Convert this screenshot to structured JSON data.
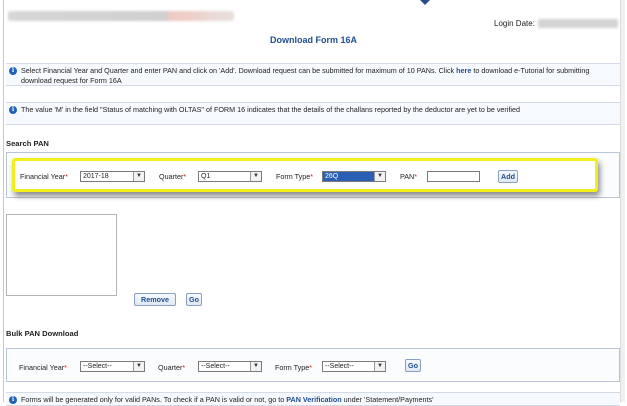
{
  "header": {
    "login_label": "Login Date:"
  },
  "page": {
    "title": "Download Form 16A"
  },
  "info1": {
    "text_before": "Select Financial Year and Quarter and enter PAN and click on 'Add'. Download request can be submitted for maximum of 10 PANs. Click ",
    "link": "here",
    "text_after": " to download e-Tutorial for submitting download request for Form 16A"
  },
  "info2": {
    "text": "The value 'M' in the field \"Status of matching with OLTAS\" of FORM 16 indicates that the details of the challans reported by the deductor are yet to be verified"
  },
  "search_pan": {
    "title": "Search PAN",
    "fy_label": "Financial Year",
    "fy_value": "2017-18",
    "quarter_label": "Quarter",
    "quarter_value": "Q1",
    "formtype_label": "Form Type",
    "formtype_value": "26Q",
    "pan_label": "PAN",
    "pan_value": "",
    "add_label": "Add",
    "remove_label": "Remove",
    "go_label": "Go"
  },
  "bulk": {
    "title": "Bulk PAN Download",
    "fy_label": "Financial Year",
    "fy_value": "--Select--",
    "quarter_label": "Quarter",
    "quarter_value": "--Select--",
    "formtype_label": "Form Type",
    "formtype_value": "--Select--",
    "go_label": "Go"
  },
  "footer_info": {
    "text_before": "Forms will be generated only for valid PANs. To check if a PAN is valid or not, go to ",
    "link": "PAN Verification",
    "text_after": " under 'Statement/Payments'"
  },
  "icons": {
    "info": "info-icon",
    "dropdown": "chevron-down-icon"
  },
  "colors": {
    "title_blue": "#1f4f8f",
    "highlight_yellow": "#f3ef1e",
    "required_red": "#d11111"
  }
}
